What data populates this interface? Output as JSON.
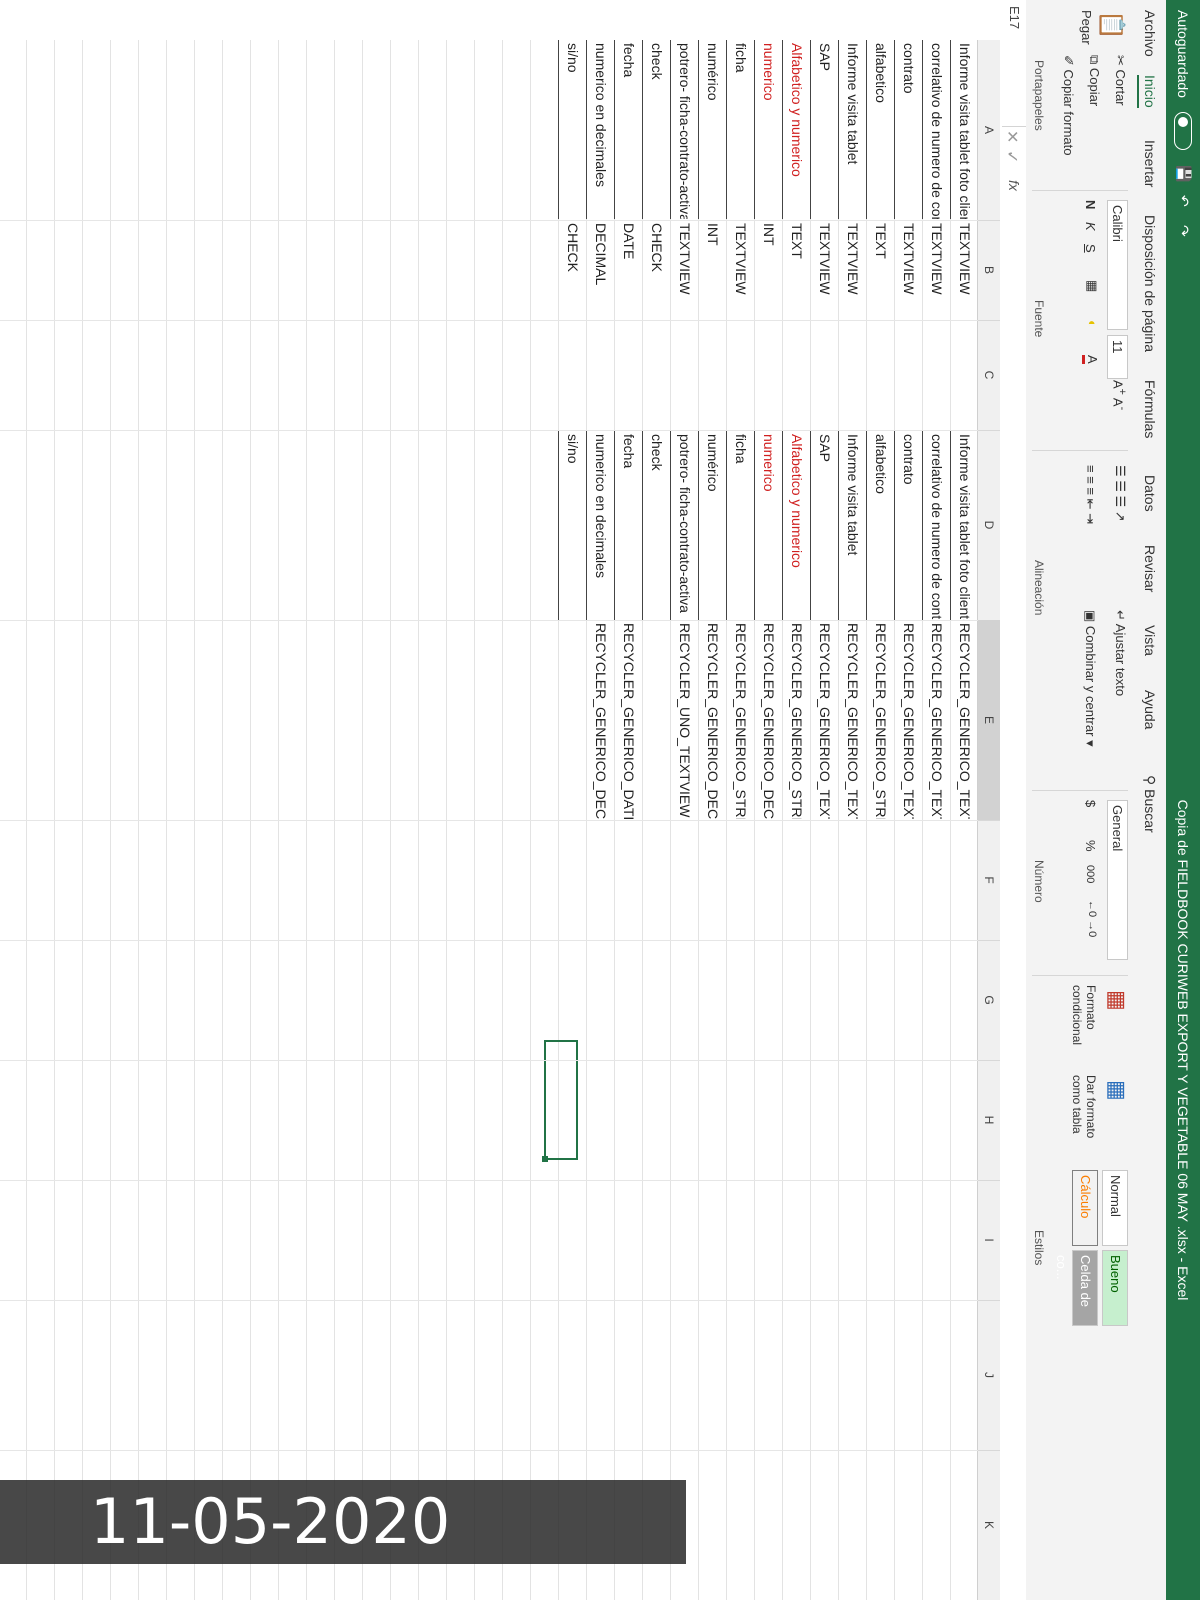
{
  "titlebar": {
    "autosave_label": "Autoguardado",
    "doc_title": "Copia de FIELDBOOK CURIWEB EXPORT Y VEGETABLE 06 MAY .xlsx - Excel"
  },
  "tabs": [
    "Archivo",
    "Inicio",
    "Insertar",
    "Disposición de página",
    "Fórmulas",
    "Datos",
    "Revisar",
    "Vista",
    "Ayuda"
  ],
  "search_label": "Buscar",
  "ribbon": {
    "paste": "Pegar",
    "cut": "Cortar",
    "copy": "Copiar",
    "format_painter": "Copiar formato",
    "clipboard_group": "Portapapeles",
    "font_name": "Calibri",
    "font_size": "11",
    "bold": "N",
    "italic": "K",
    "underline": "S",
    "font_group": "Fuente",
    "wrap_text": "Ajustar texto",
    "merge_center": "Combinar y centrar",
    "alignment_group": "Alineación",
    "number_format": "General",
    "currency": "$",
    "percent": "%",
    "thousands": "000",
    "number_group": "Número",
    "cond_format_1": "Formato",
    "cond_format_2": "condicional",
    "table_format_1": "Dar formato",
    "table_format_2": "como tabla",
    "style_normal": "Normal",
    "style_good": "Bueno",
    "style_calc": "Cálculo",
    "style_check": "Celda de co...",
    "styles_group": "Estilos"
  },
  "formula_bar": {
    "name_box": "E17",
    "fx": "fx"
  },
  "columns": [
    "A",
    "B",
    "C",
    "D",
    "E",
    "F",
    "G",
    "H",
    "I",
    "J",
    "K"
  ],
  "rows": [
    {
      "a": "Informe visita tablet foto clientes",
      "b": "TEXTVIEW",
      "d": "Informe visita tablet foto clientes",
      "e": "RECYCLER_GENERICO_TEXTVIEW",
      "red": false
    },
    {
      "a": "correlativo de numero de contrato",
      "b": "TEXTVIEW",
      "d": "correlativo de numero de contrato",
      "e": "RECYCLER_GENERICO_TEXTVIEW",
      "red": false
    },
    {
      "a": "contrato",
      "b": "TEXTVIEW",
      "d": "contrato",
      "e": "RECYCLER_GENERICO_TEXTVIEW",
      "red": false
    },
    {
      "a": "alfabetico",
      "b": "TEXT",
      "d": "alfabetico",
      "e": "RECYCLER_GENERICO_STRING",
      "red": false
    },
    {
      "a": "Informe visita tablet",
      "b": "TEXTVIEW",
      "d": "Informe visita tablet",
      "e": "RECYCLER_GENERICO_TEXTVIEW",
      "red": false
    },
    {
      "a": "SAP",
      "b": "TEXTVIEW",
      "d": "SAP",
      "e": "RECYCLER_GENERICO_TEXTVIEW",
      "red": false
    },
    {
      "a": "Alfabetico y numerico",
      "b": "TEXT",
      "d": "Alfabetico y numerico",
      "e": "RECYCLER_GENERICO_STRING",
      "red": true
    },
    {
      "a": "numerico",
      "b": "INT",
      "d": "numerico",
      "e": "RECYCLER_GENERICO_DECIMAL",
      "red": true
    },
    {
      "a": "ficha",
      "b": "TEXTVIEW",
      "d": "ficha",
      "e": "RECYCLER_GENERICO_STRING",
      "red": false
    },
    {
      "a": "numérico",
      "b": "INT",
      "d": "numérico",
      "e": "RECYCLER_GENERICO_DECIMAL",
      "red": false
    },
    {
      "a": "potrero- ficha-contrato-activa",
      "b": "TEXTVIEW",
      "d": "potrero- ficha-contrato-activa",
      "e": "RECYCLER_UNO_TEXTVIEW",
      "red": false
    },
    {
      "a": "check",
      "b": "CHECK",
      "d": "check",
      "e": "",
      "red": false
    },
    {
      "a": "fecha",
      "b": "DATE",
      "d": "fecha",
      "e": "RECYCLER_GENERICO_DATE",
      "red": false
    },
    {
      "a": "numerico en decimales",
      "b": "DECIMAL",
      "d": "numerico en decimales",
      "e": "RECYCLER_GENERICO_DECIMAL",
      "red": false
    },
    {
      "a": "si/no",
      "b": "CHECK",
      "d": "si/no",
      "e": "",
      "red": false
    }
  ],
  "photo_date_stamp": "11-05-2020"
}
